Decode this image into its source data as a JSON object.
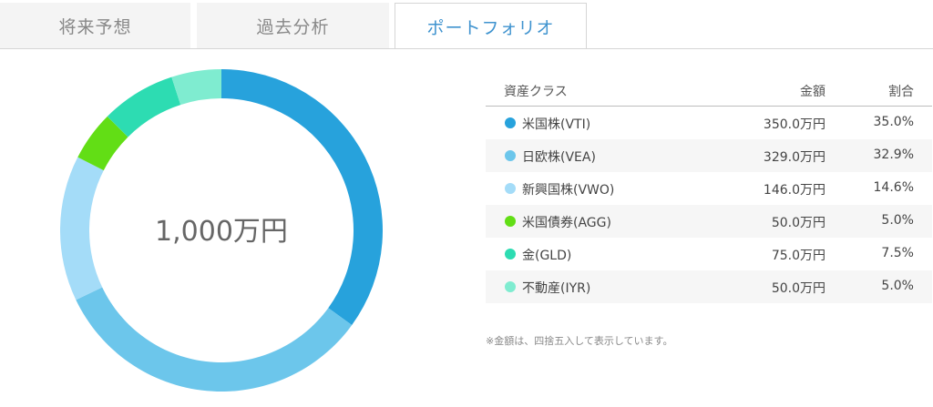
{
  "tabs": [
    {
      "label": "将来予想",
      "active": false
    },
    {
      "label": "過去分析",
      "active": false
    },
    {
      "label": "ポートフォリオ",
      "active": true
    }
  ],
  "colors": {
    "active_tab_text": "#3f93cf",
    "total_text": "#666666"
  },
  "table": {
    "headers": {
      "asset": "資産クラス",
      "amount": "金額",
      "ratio": "割合"
    },
    "note": "※金額は、四捨五入して表示しています。"
  },
  "chart_data": {
    "type": "pie",
    "center_label": "1,000万円",
    "slices": [
      {
        "label": "米国株(VTI)",
        "amount": "350.0万円",
        "percent_text": "35.0%",
        "value": 35.0,
        "color": "#27a2dc"
      },
      {
        "label": "日欧株(VEA)",
        "amount": "329.0万円",
        "percent_text": "32.9%",
        "value": 32.9,
        "color": "#6cc6eb"
      },
      {
        "label": "新興国株(VWO)",
        "amount": "146.0万円",
        "percent_text": "14.6%",
        "value": 14.6,
        "color": "#a4dcf8"
      },
      {
        "label": "米国債券(AGG)",
        "amount": "50.0万円",
        "percent_text": "5.0%",
        "value": 5.0,
        "color": "#62de15"
      },
      {
        "label": "金(GLD)",
        "amount": "75.0万円",
        "percent_text": "7.5%",
        "value": 7.5,
        "color": "#2ddcb2"
      },
      {
        "label": "不動産(IYR)",
        "amount": "50.0万円",
        "percent_text": "5.0%",
        "value": 5.0,
        "color": "#7fecd0"
      }
    ]
  }
}
